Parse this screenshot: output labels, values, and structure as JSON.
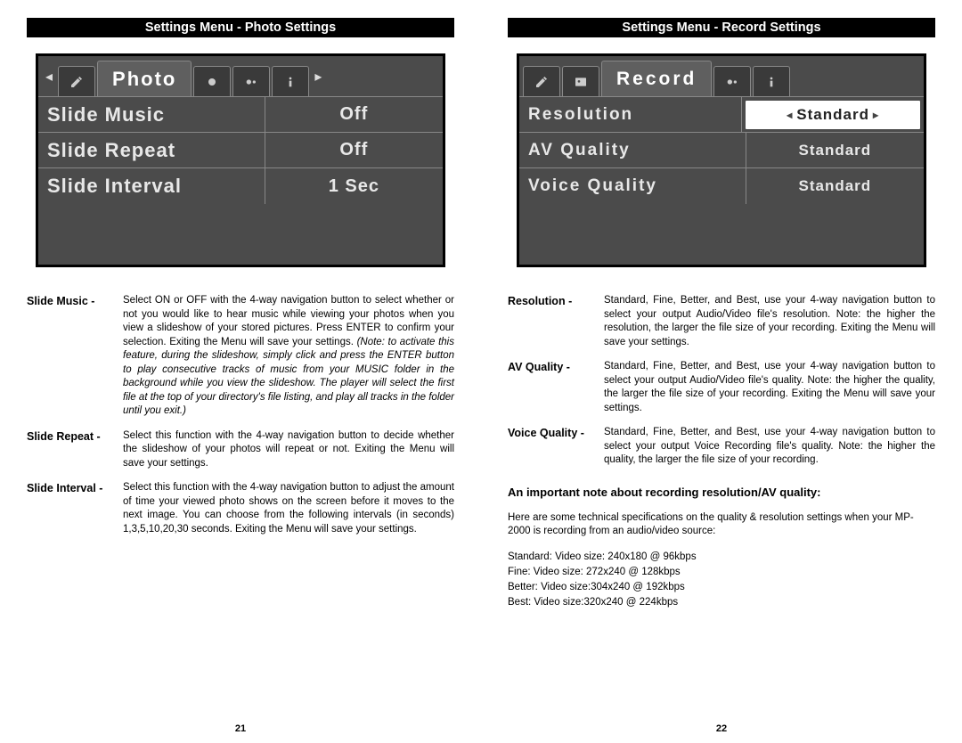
{
  "left": {
    "header": "Settings Menu - Photo Settings",
    "tab_active": "Photo",
    "rows": [
      {
        "label": "Slide Music",
        "value": "Off"
      },
      {
        "label": "Slide Repeat",
        "value": "Off"
      },
      {
        "label": "Slide Interval",
        "value": "1 Sec"
      }
    ],
    "descs": [
      {
        "term": "Slide Music",
        "body": "Select ON or OFF with the 4-way navigation button to select whether or not you would like to hear music while viewing your photos when you view a slideshow of your stored pictures. Press ENTER to confirm your selection. Exiting the Menu will save your settings. ",
        "italic": "(Note: to activate this feature, during the slideshow, simply click and press the ENTER button to play consecutive tracks of music from your MUSIC folder in the background while you view the slideshow. The player will select the first file at the top of your directory's file listing, and play all tracks in the folder until you exit.)"
      },
      {
        "term": "Slide Repeat",
        "body": "Select this function with the 4-way navigation button to decide whether the slideshow of your photos will repeat or not. Exiting the Menu will save your settings.",
        "italic": ""
      },
      {
        "term": "Slide Interval",
        "body": "Select this function with the 4-way navigation button to adjust the amount of time your viewed photo shows on the screen before it moves to the next image.  You can choose from the following intervals (in seconds) 1,3,5,10,20,30 seconds. Exiting the Menu will save your settings.",
        "italic": ""
      }
    ],
    "pagenum": "21"
  },
  "right": {
    "header": "Settings Menu - Record Settings",
    "tab_active": "Record",
    "rows": [
      {
        "label": "Resolution",
        "value": "Standard",
        "hl": true
      },
      {
        "label": "AV Quality",
        "value": "Standard"
      },
      {
        "label": "Voice Quality",
        "value": "Standard"
      }
    ],
    "descs": [
      {
        "term": "Resolution",
        "body": "Standard, Fine, Better, and Best, use your 4-way navigation button to select your output Audio/Video file's resolution.  Note: the higher the resolution, the larger the file size of your recording. Exiting the Menu will save your settings.",
        "italic": ""
      },
      {
        "term": "AV Quality",
        "body": "Standard, Fine, Better, and Best, use your 4-way navigation button to select your output Audio/Video file's quality.  Note: the higher the quality, the larger the file size of your recording. Exiting the Menu will save your settings.",
        "italic": ""
      },
      {
        "term": "Voice Quality",
        "body": "Standard, Fine, Better, and Best, use your 4-way navigation button to select your output Voice Recording file's quality.  Note: the higher the quality, the larger the file size of your recording.",
        "italic": ""
      }
    ],
    "note_heading": "An important note about recording resolution/AV quality:",
    "note_body": "Here are some technical specifications on the quality & resolution settings when your MP-2000 is recording from an audio/video source:",
    "specs": [
      "Standard: Video size:  240x180 @ 96kbps",
      "Fine: Video size: 272x240 @ 128kbps",
      "Better: Video size:304x240 @ 192kbps",
      "Best: Video size:320x240 @ 224kbps"
    ],
    "pagenum": "22"
  }
}
